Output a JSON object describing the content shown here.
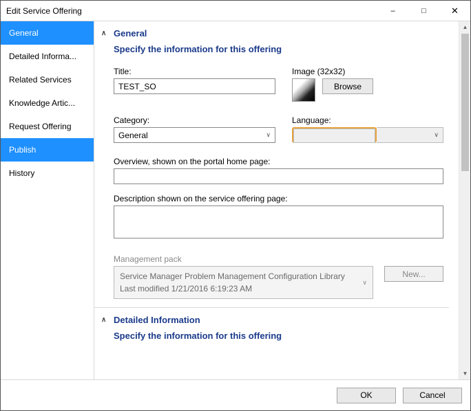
{
  "window": {
    "title": "Edit Service Offering"
  },
  "sidebar": {
    "items": [
      {
        "label": "General",
        "selected": true
      },
      {
        "label": "Detailed Informa...",
        "selected": false
      },
      {
        "label": "Related Services",
        "selected": false
      },
      {
        "label": "Knowledge Artic...",
        "selected": false
      },
      {
        "label": "Request Offering",
        "selected": false
      },
      {
        "label": "Publish",
        "selected": true
      },
      {
        "label": "History",
        "selected": false
      }
    ]
  },
  "section_general": {
    "header": "General",
    "subheader": "Specify the information for this offering",
    "title_label": "Title:",
    "title_value": "TEST_SO",
    "image_label": "Image (32x32)",
    "browse_label": "Browse",
    "category_label": "Category:",
    "category_value": "General",
    "language_label": "Language:",
    "language_value": "",
    "overview_label": "Overview, shown on the portal home page:",
    "overview_value": "",
    "description_label": "Description shown on the service offering page:",
    "description_value": "",
    "mp_label": "Management pack",
    "mp_name": "Service Manager Problem Management Configuration Library",
    "mp_modified_prefix": "Last modified  ",
    "mp_modified": "1/21/2016 6:19:23 AM",
    "new_label": "New..."
  },
  "section_detail": {
    "header": "Detailed Information",
    "subheader": "Specify the information for this offering"
  },
  "footer": {
    "ok": "OK",
    "cancel": "Cancel"
  }
}
